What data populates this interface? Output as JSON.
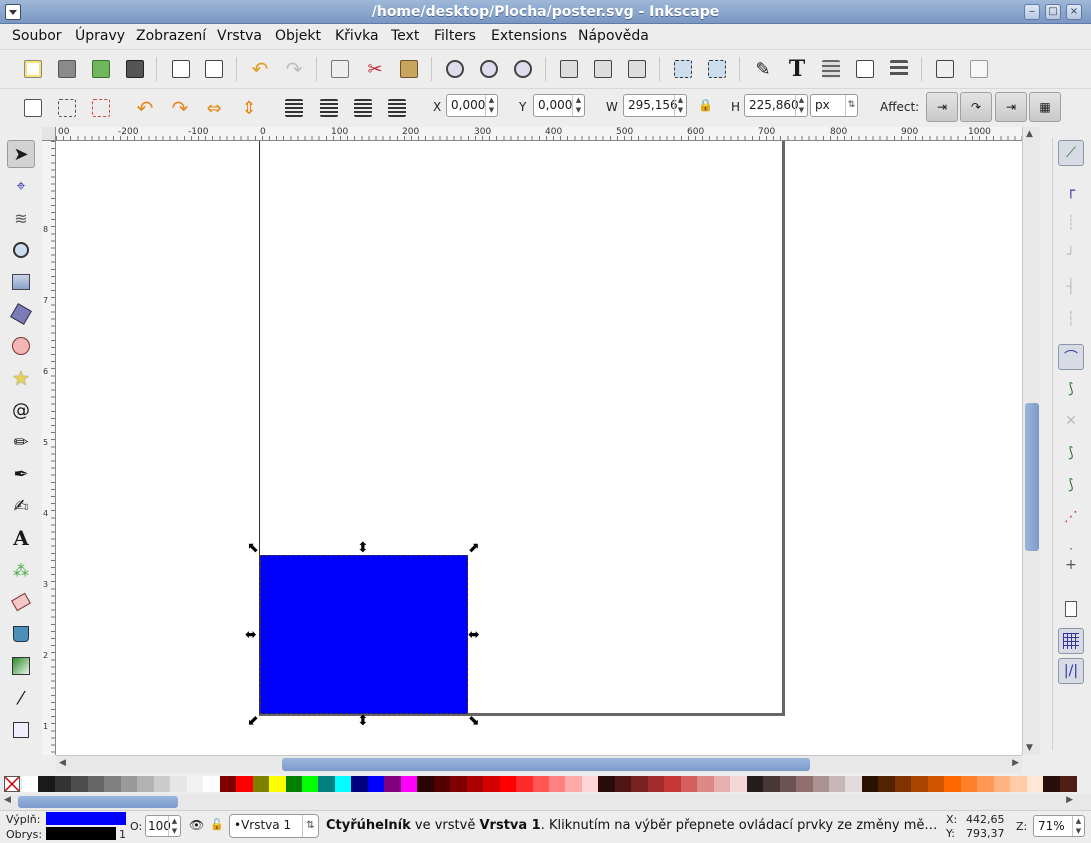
{
  "window": {
    "title": "/home/desktop/Plocha/poster.svg - Inkscape"
  },
  "menu": [
    "Soubor",
    "Úpravy",
    "Zobrazení",
    "Vrstva",
    "Objekt",
    "Křivka",
    "Text",
    "Filters",
    "Extensions",
    "Nápověda"
  ],
  "toolbar": {
    "icons": [
      "new-icon",
      "open-icon",
      "import-save-icon",
      "print-icon",
      "import-icon",
      "export-icon",
      "undo-icon",
      "redo-icon",
      "copy-icon",
      "cut-icon",
      "paste-icon",
      "zoom-selection-icon",
      "zoom-drawing-icon",
      "zoom-page-icon",
      "duplicate-icon",
      "clone-icon",
      "unlink-clone-icon",
      "group-icon",
      "ungroup-icon",
      "fill-stroke-icon",
      "text-font-icon",
      "layers-icon",
      "xml-editor-icon",
      "align-icon",
      "document-properties-icon",
      "preferences-icon"
    ],
    "text_tool_glyph": "T"
  },
  "selectbar": {
    "x_label": "X",
    "x_value": "0,000",
    "y_label": "Y",
    "y_value": "0,000",
    "w_label": "W",
    "w_value": "295,156",
    "h_label": "H",
    "h_value": "225,860",
    "unit": "px",
    "affect_label": "Affect:"
  },
  "ruler": {
    "h_labels": [
      "00",
      "-200",
      "-100",
      "0",
      "100",
      "200",
      "300",
      "400",
      "500",
      "600",
      "700",
      "800",
      "900",
      "1000"
    ],
    "v_labels": [
      "8",
      "7",
      "6",
      "5",
      "4",
      "3",
      "2",
      "1"
    ]
  },
  "tools": [
    "selector-arrow-icon",
    "node-edit-icon",
    "tweak-icon",
    "zoom-icon",
    "rectangle-icon",
    "3d-box-icon",
    "ellipse-icon",
    "star-icon",
    "spiral-icon",
    "pencil-icon",
    "pen-icon",
    "calligraphy-icon",
    "text-tool-icon",
    "spray-icon",
    "eraser-icon",
    "paint-bucket-icon",
    "gradient-icon",
    "dropper-icon",
    "connector-icon"
  ],
  "text_tool_glyph": "A",
  "palette": [
    "#ffffff",
    "#1a1a1a",
    "#333333",
    "#4d4d4d",
    "#666666",
    "#808080",
    "#999999",
    "#b3b3b3",
    "#cccccc",
    "#e6e6e6",
    "#f2f2f2",
    "#ffffff",
    "#800000",
    "#ff0000",
    "#808000",
    "#ffff00",
    "#008000",
    "#00ff00",
    "#008080",
    "#00ffff",
    "#000080",
    "#0000ff",
    "#800080",
    "#ff00ff",
    "#2b0000",
    "#550000",
    "#800000",
    "#aa0000",
    "#d40000",
    "#ff0000",
    "#ff2a2a",
    "#ff5555",
    "#ff8080",
    "#ffaaaa",
    "#ffd5d5",
    "#280b0b",
    "#501616",
    "#782121",
    "#a02c2c",
    "#c83737",
    "#d35f5f",
    "#de8787",
    "#e9afaf",
    "#f4d7d7",
    "#241c1c",
    "#483737",
    "#6c5353",
    "#916f6f",
    "#ac9393",
    "#c8b7b7",
    "#e3dbdb",
    "#2b1100",
    "#552200",
    "#803300",
    "#aa4400",
    "#d45500",
    "#ff6600",
    "#ff7f2a",
    "#ff9955",
    "#ffb380",
    "#ffccaa",
    "#ffe6d5",
    "#280f0b",
    "#501e16"
  ],
  "status": {
    "fill_label": "Výplň:",
    "stroke_label": "Obrys:",
    "fill_color": "#0000ff",
    "stroke_color": "#000000",
    "stroke_width": "1",
    "opacity_label": "O:",
    "opacity_value": "100",
    "layer": "•Vrstva 1",
    "message_bold1": "Čtyřúhelník",
    "message_part1": " ve vrstvě ",
    "message_bold2": "Vrstva 1",
    "message_part2": ". Kliknutím na výběr přepnete ovládací prvky ze změny mě…",
    "x_label": "X:",
    "x_value": "442,65",
    "y_label": "Y:",
    "y_value": "793,37",
    "zoom_label": "Z:",
    "zoom_value": "71%"
  },
  "canvas": {
    "rect_fill": "#0000ff"
  }
}
